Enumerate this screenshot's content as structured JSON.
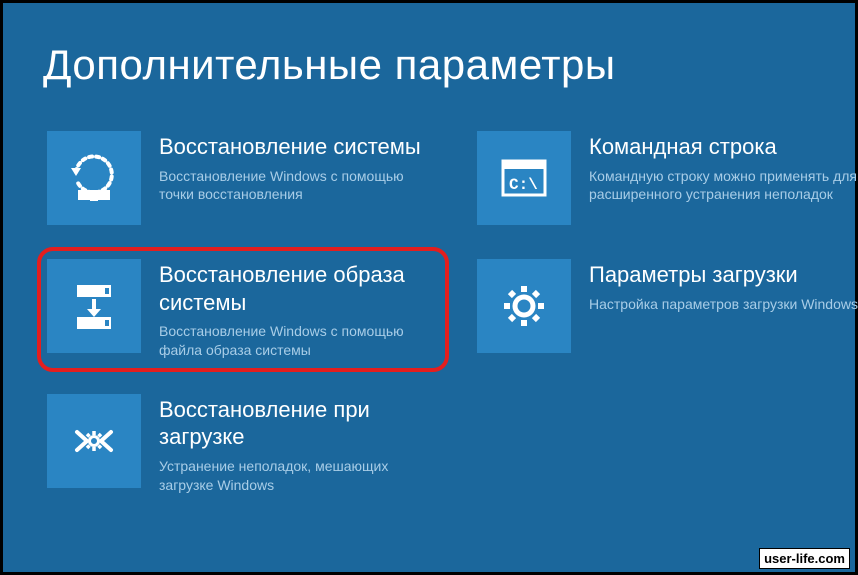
{
  "page_title": "Дополнительные параметры",
  "options": {
    "system_restore": {
      "icon": "system-restore-icon",
      "title": "Восстановление системы",
      "desc": "Восстановление Windows с помощью точки восстановления"
    },
    "image_recovery": {
      "icon": "image-recovery-icon",
      "title": "Восстановление образа системы",
      "desc": "Восстановление Windows с помощью файла образа системы",
      "highlighted": true
    },
    "startup_repair": {
      "icon": "startup-repair-icon",
      "title": "Восстановление при загрузке",
      "desc": "Устранение неполадок, мешающих загрузке Windows"
    },
    "command_prompt": {
      "icon": "command-prompt-icon",
      "title": "Командная строка",
      "desc": "Командную строку можно применять для расширенного устранения неполадок"
    },
    "startup_settings": {
      "icon": "startup-settings-icon",
      "title": "Параметры загрузки",
      "desc": "Настройка параметров загрузки Windows"
    }
  },
  "watermark": "user-life.com"
}
